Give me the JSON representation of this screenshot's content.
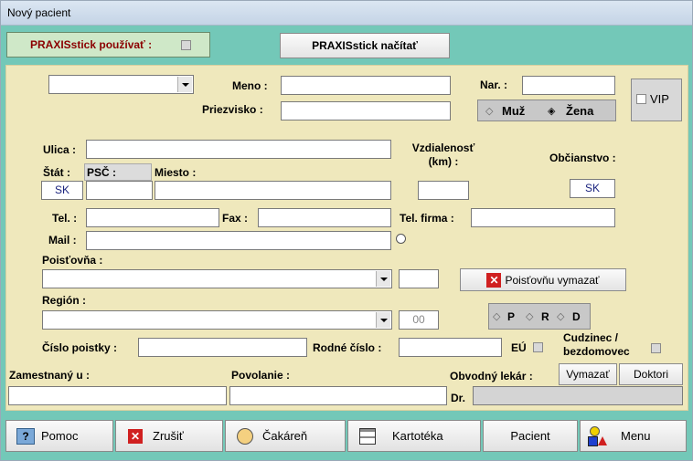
{
  "window": {
    "title": "Nový pacient"
  },
  "top": {
    "use_praxisstick_label": "PRAXISstick používať :",
    "read_praxisstick_label": "PRAXISstick načítať"
  },
  "form": {
    "meno_label": "Meno :",
    "priezvisko_label": "Priezvisko :",
    "nar_label": "Nar. :",
    "vip_label": "VIP",
    "gender": {
      "male": "Muž",
      "female": "Žena",
      "selected": "female"
    },
    "ulica_label": "Ulica :",
    "vzdialenost_label": "Vzdialenosť (km) :",
    "obcianstvo_label": "Občianstvo :",
    "obcianstvo_value": "SK",
    "stat_label": "Štát :",
    "stat_value": "SK",
    "psc_label": "PSČ :",
    "miesto_label": "Miesto :",
    "tel_label": "Tel. :",
    "fax_label": "Fax :",
    "tel_firma_label": "Tel. firma :",
    "mail_label": "Mail :",
    "poistovna_label": "Poisťovňa :",
    "poistovna_delete_label": "Poisťovňu vymazať",
    "region_label": "Región :",
    "region_code": "00",
    "prd": {
      "p": "P",
      "r": "R",
      "d": "D"
    },
    "cislo_poistky_label": "Číslo poistky :",
    "rodne_cislo_label": "Rodné číslo :",
    "eu_label": "EÚ",
    "cudzinec_label": "Cudzinec /",
    "bezdomovec_label": "bezdomovec",
    "zamestnany_label": "Zamestnaný u :",
    "povolanie_label": "Povolanie :",
    "obvodny_lekar_label": "Obvodný lekár :",
    "vymazat_label": "Vymazať",
    "doktori_label": "Doktori",
    "dr_label": "Dr."
  },
  "bottom": {
    "pomoc": "Pomoc",
    "zrusit": "Zrušiť",
    "cakaren": "Čakáreň",
    "kartoteka": "Kartotéka",
    "pacient": "Pacient",
    "menu": "Menu"
  },
  "colors": {
    "background": "#73c8b8",
    "panel": "#efe8bc",
    "accent_text": "#8b0000"
  }
}
